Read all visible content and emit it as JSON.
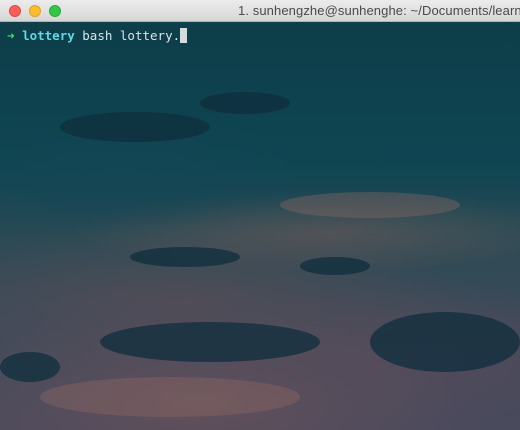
{
  "window": {
    "title": "1. sunhengzhe@sunhenghe: ~/Documents/learn"
  },
  "terminal": {
    "prompt_symbol": "➜",
    "cwd": "lottery",
    "command": "bash lottery."
  },
  "colors": {
    "prompt_arrow": "#45e06a",
    "cwd": "#5fd8e8",
    "command_text": "#d9e4e6",
    "background": "#0c3d4a"
  }
}
